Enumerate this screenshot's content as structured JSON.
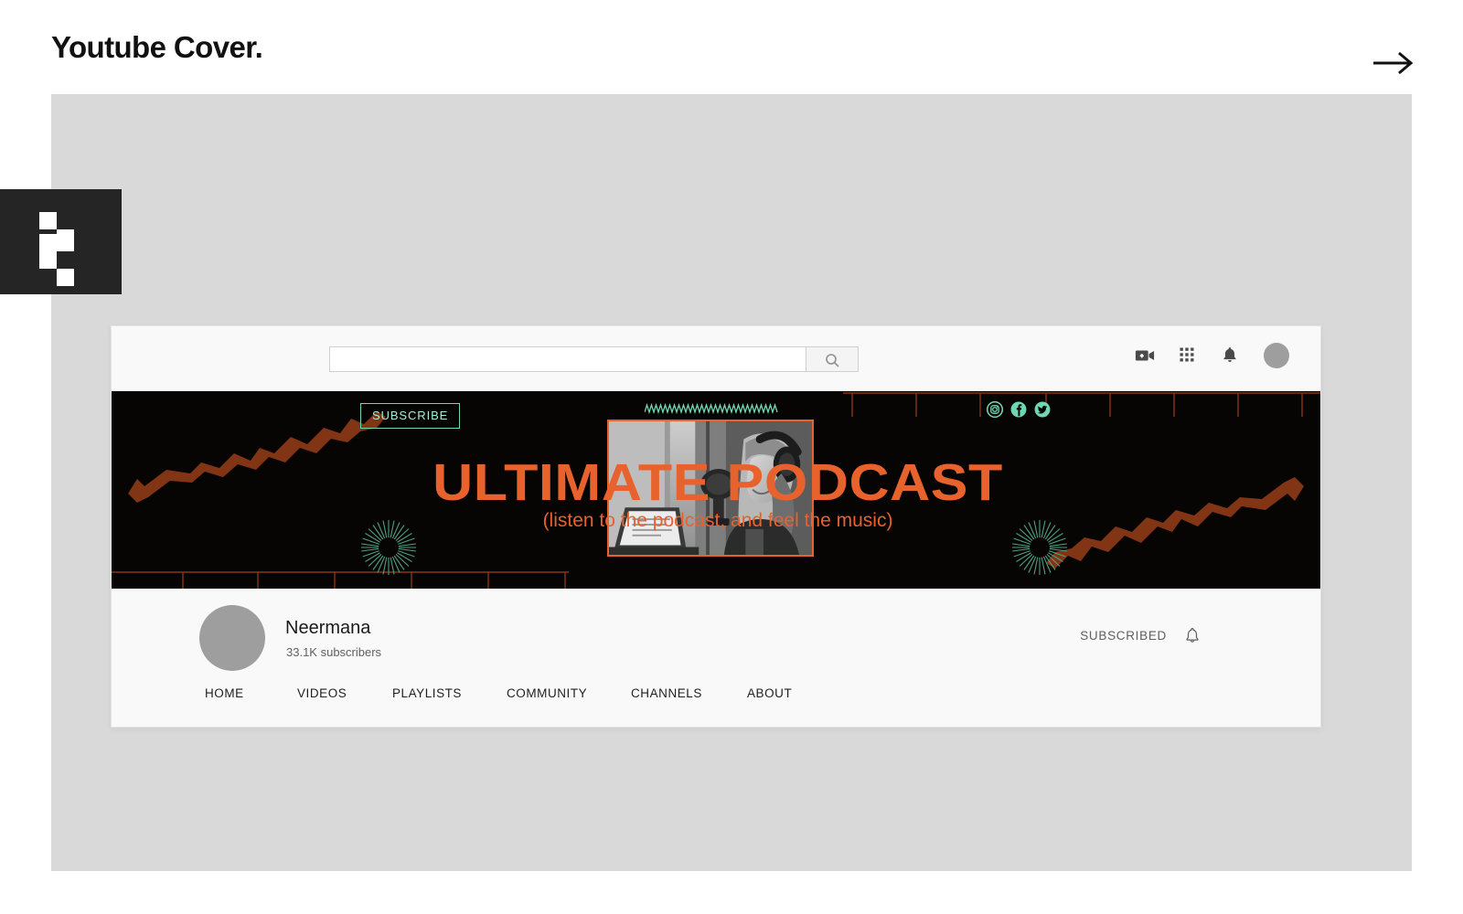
{
  "page": {
    "title": "Youtube Cover.",
    "next_arrow_icon": "arrow-right-icon",
    "logo_icon": "pixel-logo-icon",
    "background_color": "#d9d9d9"
  },
  "youtube": {
    "header": {
      "search_value": "",
      "search_placeholder": "",
      "search_button_icon": "search-icon",
      "icons": [
        {
          "name": "create-video-icon",
          "label": "Create"
        },
        {
          "name": "apps-grid-icon",
          "label": "YouTube apps"
        },
        {
          "name": "bell-icon",
          "label": "Notifications"
        }
      ],
      "avatar_icon": "account-avatar"
    },
    "banner": {
      "background_color": "#070404",
      "accent_orange": "#e8622d",
      "accent_mint": "#6fd8b0",
      "grid_line_color": "#8a3415",
      "subscribe_label": "SUBSCRIBE",
      "wave_icon": "zigzag-wave-decoration",
      "socials": [
        {
          "name": "instagram-icon",
          "label": "Instagram"
        },
        {
          "name": "facebook-icon",
          "label": "Facebook"
        },
        {
          "name": "twitter-icon",
          "label": "Twitter"
        }
      ],
      "photo_alt": "podcast-host-photo",
      "title": "ULTIMATE PODCAST",
      "subtitle": "(listen to the podcast, and feel the music)",
      "sunburst_icon": "sunburst-decoration",
      "zigzag_icon": "zigzag-ribbon-decoration"
    },
    "channel": {
      "avatar_icon": "channel-avatar",
      "name": "Neermana",
      "subscribers": "33.1K subscribers",
      "subscribed_label": "SUBSCRIBED",
      "bell_icon": "bell-outline-icon",
      "tabs": [
        {
          "label": "HOME"
        },
        {
          "label": "VIDEOS"
        },
        {
          "label": "PLAYLISTS"
        },
        {
          "label": "COMMUNITY"
        },
        {
          "label": "CHANNELS"
        },
        {
          "label": "ABOUT"
        }
      ]
    }
  }
}
